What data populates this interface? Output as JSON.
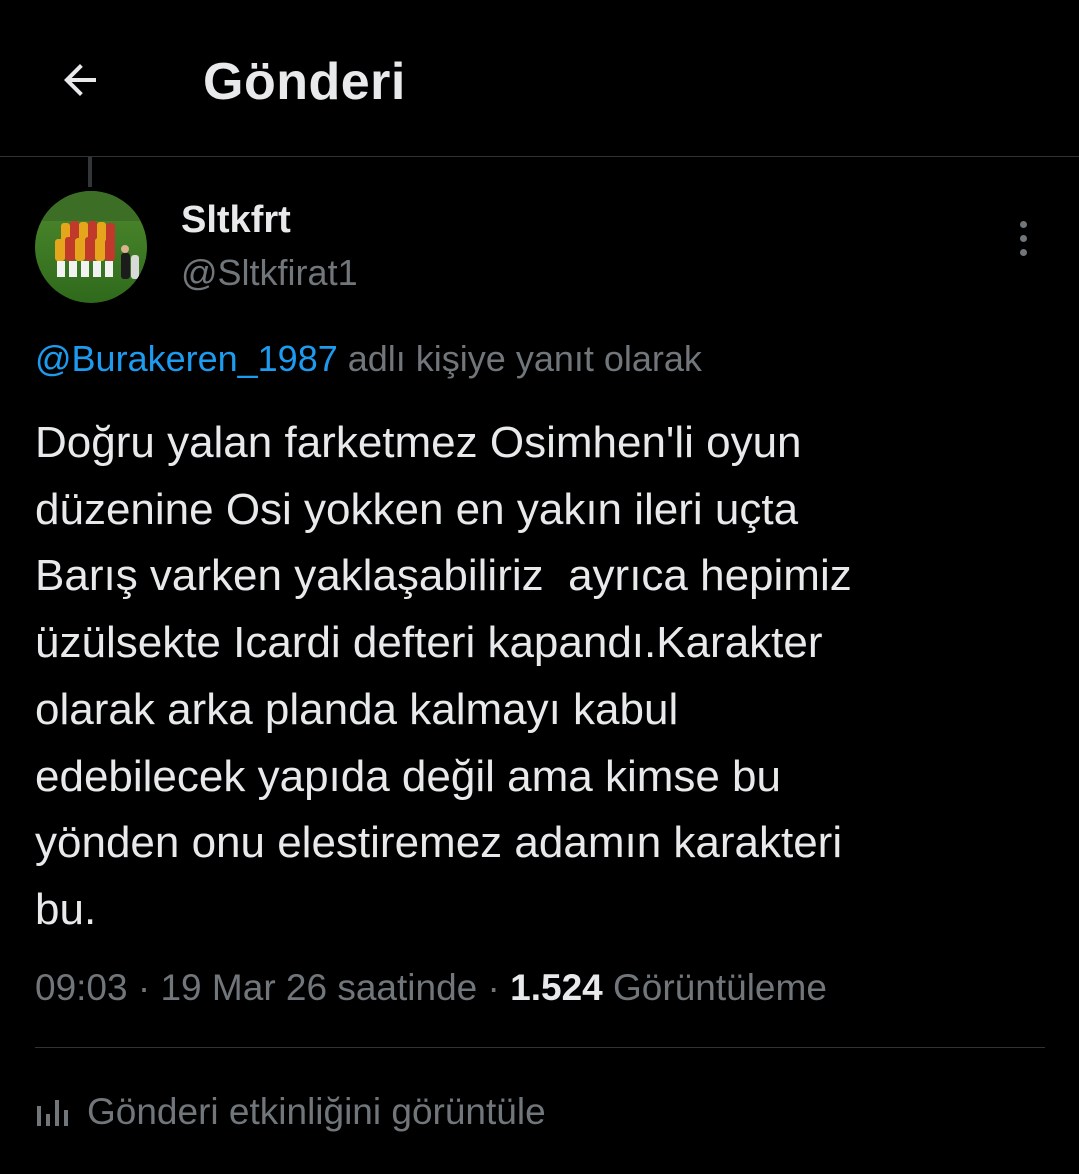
{
  "header": {
    "title": "Gönderi",
    "back_icon": "arrow-left-icon"
  },
  "tweet": {
    "author": {
      "display_name": "Sltkfrt",
      "handle": "@Sltkfirat1",
      "avatar_icon": "avatar-team-photo"
    },
    "more_icon": "more-vertical-icon",
    "reply_to": {
      "handle": "@Burakeren_1987",
      "suffix": " adlı kişiye yanıt olarak"
    },
    "text": "Doğru yalan farketmez Osimhen'li oyun\ndüzenine Osi yokken en yakın ileri uçta\nBarış varken yaklaşabiliriz  ayrıca hepimiz\nüzülsekte Icardi defteri kapandı.Karakter\nolarak arka planda kalmayı kabul\nedebilecek yapıda değil ama kimse bu\nyönden onu elestiremez adamın karakteri\nbu.",
    "meta": {
      "time": "09:03",
      "separator": " · ",
      "date": "19 Mar 26 saatinde",
      "separator2": " · ",
      "views_count": "1.524",
      "views_label": " Görüntüleme"
    },
    "analytics": {
      "icon": "analytics-bars-icon",
      "label": "Gönderi etkinliğini görüntüle"
    }
  },
  "colors": {
    "background": "#000000",
    "text_primary": "#e7e9ea",
    "text_secondary": "#71767b",
    "link": "#1d9bf0",
    "border": "#2f3336"
  }
}
